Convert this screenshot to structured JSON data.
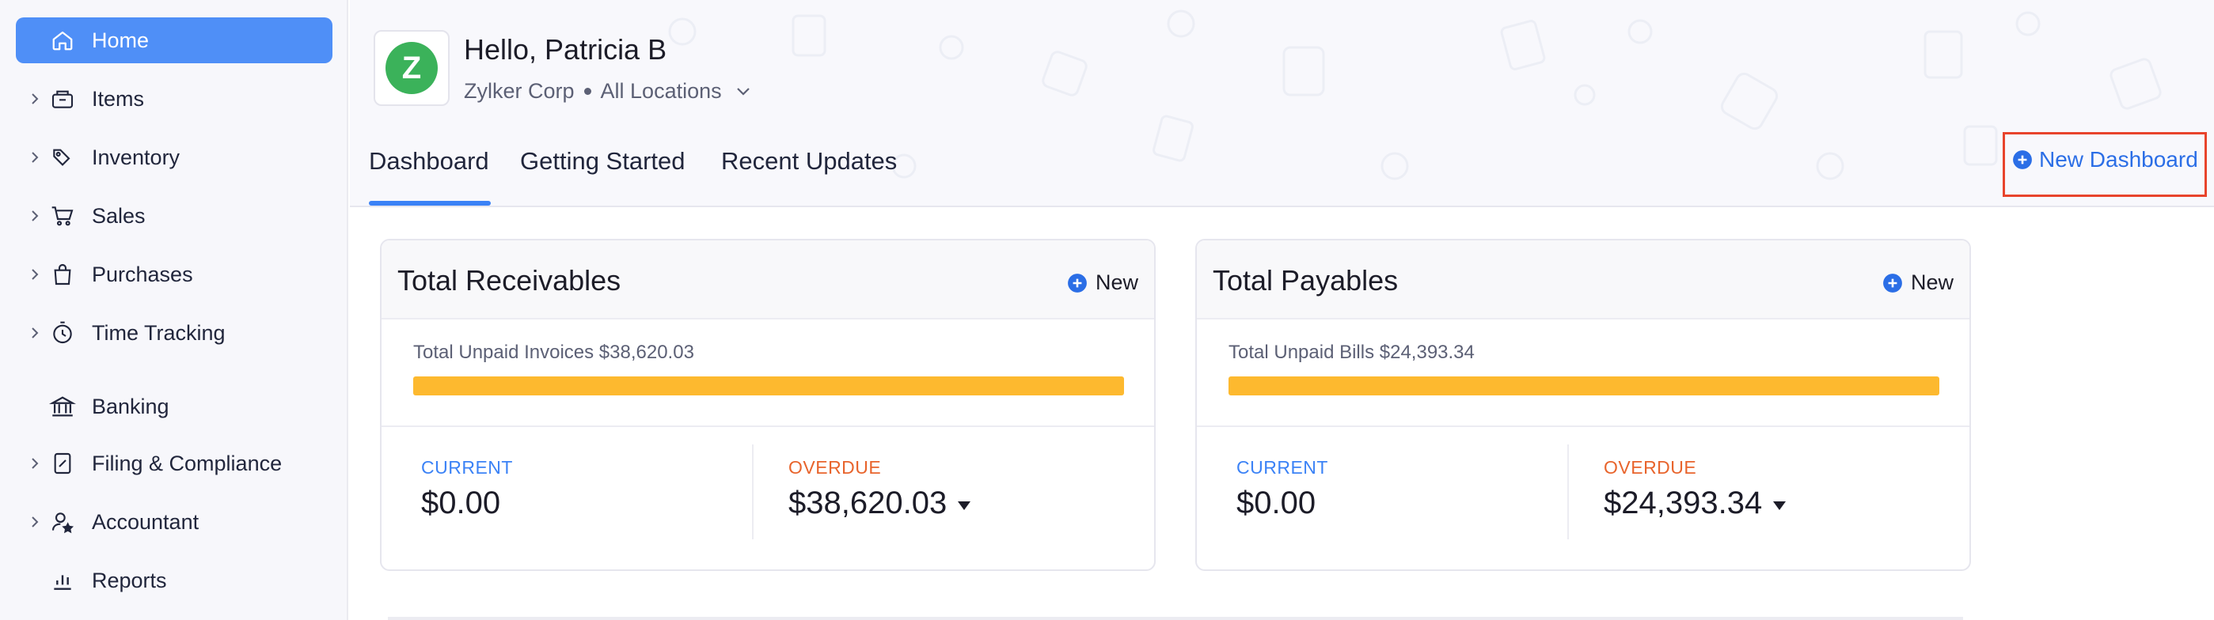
{
  "sidebar": {
    "items": [
      {
        "label": "Home",
        "icon": "home-icon",
        "active": true,
        "expandable": false
      },
      {
        "label": "Items",
        "icon": "basket-icon",
        "active": false,
        "expandable": true
      },
      {
        "label": "Inventory",
        "icon": "inventory-icon",
        "active": false,
        "expandable": true
      },
      {
        "label": "Sales",
        "icon": "cart-icon",
        "active": false,
        "expandable": true
      },
      {
        "label": "Purchases",
        "icon": "bag-icon",
        "active": false,
        "expandable": true
      },
      {
        "label": "Time Tracking",
        "icon": "stopwatch-icon",
        "active": false,
        "expandable": true
      },
      {
        "label": "Banking",
        "icon": "bank-icon",
        "active": false,
        "expandable": false
      },
      {
        "label": "Filing & Compliance",
        "icon": "filing-icon",
        "active": false,
        "expandable": true
      },
      {
        "label": "Accountant",
        "icon": "accountant-icon",
        "active": false,
        "expandable": true
      },
      {
        "label": "Reports",
        "icon": "reports-icon",
        "active": false,
        "expandable": false
      }
    ]
  },
  "header": {
    "logo_letter": "Z",
    "greeting": "Hello, Patricia B",
    "org_name": "Zylker Corp",
    "location": "All Locations",
    "tabs": [
      {
        "label": "Dashboard",
        "active": true
      },
      {
        "label": "Getting Started",
        "active": false
      },
      {
        "label": "Recent Updates",
        "active": false
      }
    ],
    "new_dashboard_label": "New Dashboard"
  },
  "receivables": {
    "title": "Total Receivables",
    "new_label": "New",
    "unpaid_label": "Total Unpaid Invoices $38,620.03",
    "current_label": "CURRENT",
    "current_value": "$0.00",
    "overdue_label": "OVERDUE",
    "overdue_value": "$38,620.03",
    "overdue_fraction": 1.0
  },
  "payables": {
    "title": "Total Payables",
    "new_label": "New",
    "unpaid_label": "Total Unpaid Bills $24,393.34",
    "current_label": "CURRENT",
    "current_value": "$0.00",
    "overdue_label": "OVERDUE",
    "overdue_value": "$24,393.34",
    "overdue_fraction": 1.0
  },
  "colors": {
    "accent": "#4f8ff7",
    "link": "#2b6ee6",
    "overdue_bar": "#fdb92f",
    "overdue_text": "#e8642c",
    "highlight_box": "#e8442c",
    "logo_green": "#3bb25a"
  }
}
